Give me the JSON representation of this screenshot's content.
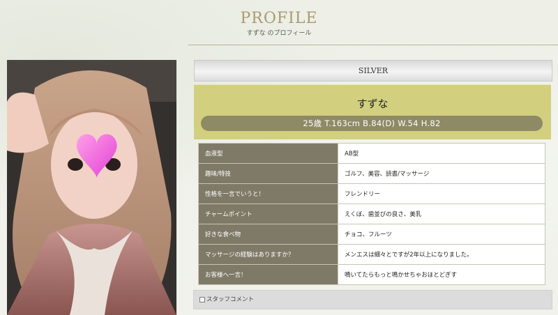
{
  "header": {
    "title": "PROFILE",
    "subtitle": "すずな のプロフィール"
  },
  "profile": {
    "rank": "SILVER",
    "name": "すずな",
    "stats": "25歳 T.163cm B.84(D) W.54 H.82",
    "photo_overlay_icon": "heart-icon"
  },
  "details": [
    {
      "label": "血液型",
      "value": "AB型"
    },
    {
      "label": "趣味/特技",
      "value": "ゴルフ、美容、読書/マッサージ"
    },
    {
      "label": "性格を一言でいうと！",
      "value": "フレンドリー"
    },
    {
      "label": "チャームポイント",
      "value": "えくぼ、歯並びの良さ、美乳"
    },
    {
      "label": "好きな食べ物",
      "value": "チョコ、フルーツ"
    },
    {
      "label": "マッサージの経験はありますか？",
      "value": "メンエスは細々とですが2年以上になりました。"
    },
    {
      "label": "お客様へ一言！",
      "value": "鳴いてたらもっと鳴かせちゃおほとどぎす"
    }
  ],
  "staff_comment": {
    "label": "スタッフコメント"
  },
  "colors": {
    "accent_gold": "#a99a6f",
    "name_box": "#d2cf7e",
    "stats_pill": "#8e8a66",
    "label_cell": "#7f7a68"
  }
}
